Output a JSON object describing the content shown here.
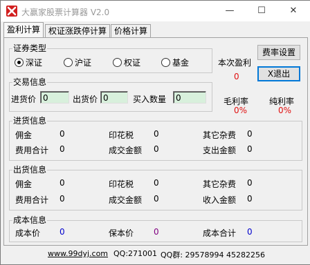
{
  "window": {
    "title": "大赢家股票计算器 V2.0",
    "controls": {
      "minimize": "—",
      "maximize": "☐",
      "close": "✕"
    }
  },
  "tabs": [
    {
      "label": "盈利计算",
      "active": true
    },
    {
      "label": "权证涨跌停计算",
      "active": false
    },
    {
      "label": "价格计算",
      "active": false
    }
  ],
  "securities": {
    "title": "证券类型",
    "options": [
      {
        "label": "深证",
        "checked": true
      },
      {
        "label": "沪证",
        "checked": false
      },
      {
        "label": "权证",
        "checked": false
      },
      {
        "label": "基金",
        "checked": false
      }
    ]
  },
  "trade": {
    "title": "交易信息",
    "buy_price_label": "进货价",
    "buy_price_value": "0",
    "sell_price_label": "出货价",
    "sell_price_value": "0",
    "quantity_label": "买入数量",
    "quantity_value": "0"
  },
  "profit": {
    "label": "本次盈利",
    "value": "0",
    "gross_label": "毛利率",
    "gross_value": "0%",
    "net_label": "纯利率",
    "net_value": "0%"
  },
  "buttons": {
    "fee_settings": "费率设置",
    "exit": "X退出"
  },
  "buy_info": {
    "title": "进货信息",
    "commission_label": "佣金",
    "commission_value": "0",
    "stamp_label": "印花税",
    "stamp_value": "0",
    "other_label": "其它杂费",
    "other_value": "0",
    "fee_total_label": "费用合计",
    "fee_total_value": "0",
    "deal_amount_label": "成交金额",
    "deal_amount_value": "0",
    "pay_amount_label": "支出金额",
    "pay_amount_value": "0"
  },
  "sell_info": {
    "title": "出货信息",
    "commission_label": "佣金",
    "commission_value": "0",
    "stamp_label": "印花税",
    "stamp_value": "0",
    "other_label": "其它杂费",
    "other_value": "0",
    "fee_total_label": "费用合计",
    "fee_total_value": "0",
    "deal_amount_label": "成交金额",
    "deal_amount_value": "0",
    "income_amount_label": "收入金额",
    "income_amount_value": "0"
  },
  "cost_info": {
    "title": "成本信息",
    "cost_price_label": "成本价",
    "cost_price_value": "0",
    "breakeven_label": "保本价",
    "breakeven_value": "0",
    "cost_total_label": "成本合计",
    "cost_total_value": "0"
  },
  "footer": {
    "website": "www.99dyj.com",
    "qq": "QQ:271001",
    "qq_group": "QQ群: 29578994 45282256"
  }
}
